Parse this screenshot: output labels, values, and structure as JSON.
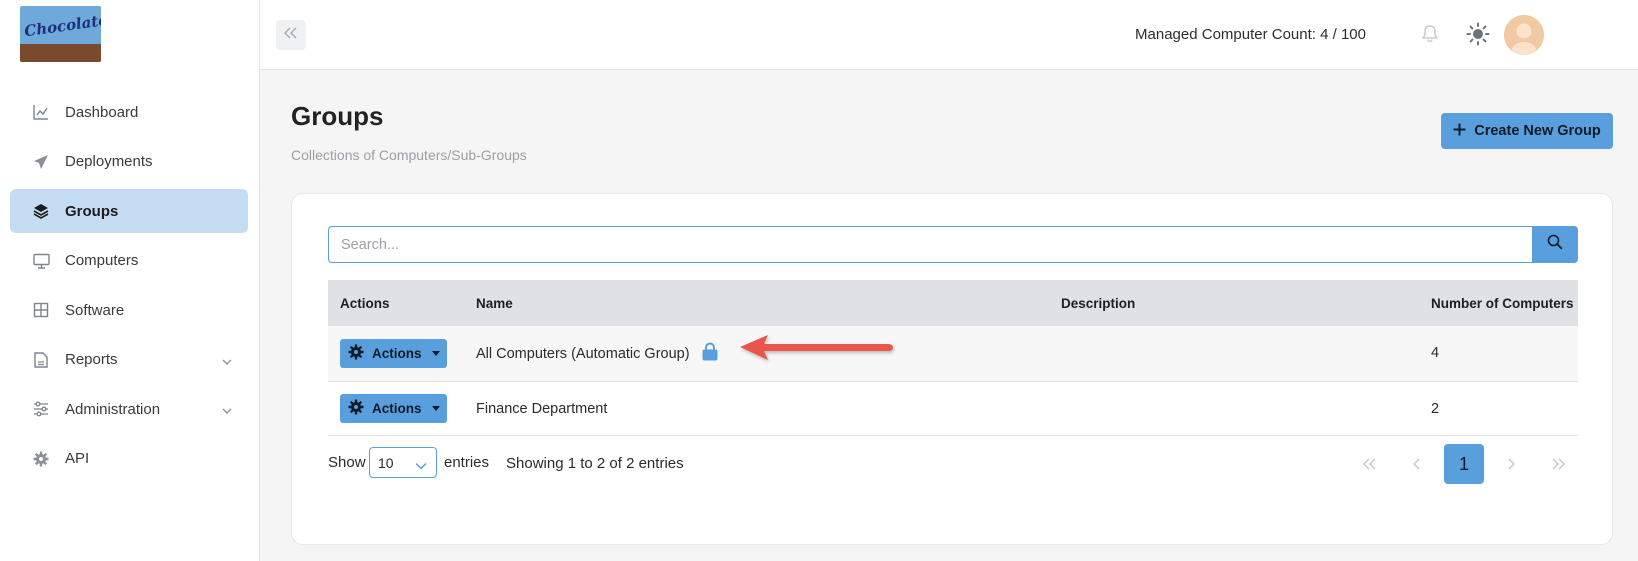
{
  "brand": {
    "logo_text": "Chocolatey"
  },
  "sidebar": {
    "items": [
      {
        "label": "Dashboard",
        "icon": "chart-line-icon"
      },
      {
        "label": "Deployments",
        "icon": "paper-plane-icon"
      },
      {
        "label": "Groups",
        "icon": "layers-icon",
        "active": true
      },
      {
        "label": "Computers",
        "icon": "desktop-icon"
      },
      {
        "label": "Software",
        "icon": "grid-icon"
      },
      {
        "label": "Reports",
        "icon": "file-icon",
        "expandable": true
      },
      {
        "label": "Administration",
        "icon": "sliders-icon",
        "expandable": true
      },
      {
        "label": "API",
        "icon": "gear-icon"
      }
    ]
  },
  "topbar": {
    "managed_count": "Managed Computer Count: 4 / 100"
  },
  "page": {
    "title": "Groups",
    "subtitle": "Collections of Computers/Sub-Groups",
    "create_button": "Create New Group"
  },
  "search": {
    "placeholder": "Search..."
  },
  "table": {
    "columns": [
      "Actions",
      "Name",
      "Description",
      "Number of Computers"
    ],
    "rows": [
      {
        "action": "Actions",
        "name": "All Computers (Automatic Group)",
        "description": "",
        "count": "4",
        "locked": true
      },
      {
        "action": "Actions",
        "name": "Finance Department",
        "description": "",
        "count": "2",
        "locked": false
      }
    ]
  },
  "footer": {
    "show": "Show",
    "page_length": "10",
    "entries": "entries",
    "info": "Showing 1 to 2 of 2 entries",
    "current_page": "1"
  },
  "colors": {
    "accent": "#5a9fdd",
    "active_nav": "#c5ddf3",
    "annotation_arrow": "#e8574a"
  }
}
